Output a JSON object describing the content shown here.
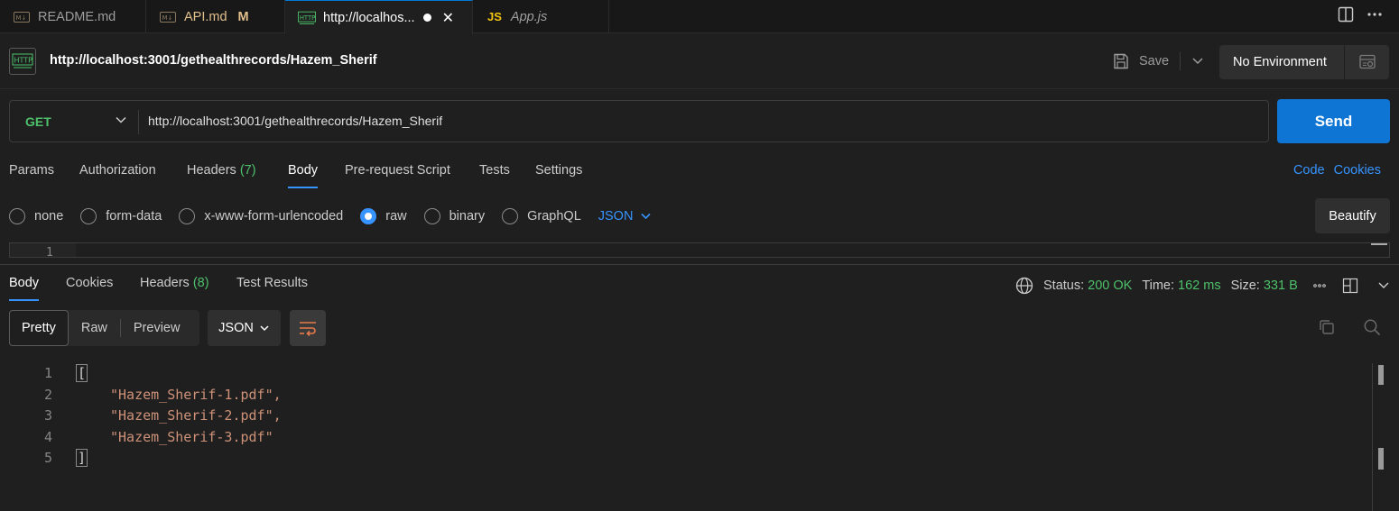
{
  "tabs": [
    {
      "label": "README.md",
      "icon": "markdown-icon"
    },
    {
      "label": "API.md",
      "icon": "markdown-icon",
      "badge": "M"
    },
    {
      "label": "http://localhos...",
      "icon": "http-icon"
    },
    {
      "label": "App.js",
      "icon": "js-icon",
      "icon_text": "JS"
    }
  ],
  "request": {
    "title": "http://localhost:3001/gethealthrecords/Hazem_Sherif",
    "save_label": "Save",
    "environment": "No Environment",
    "method": "GET",
    "url": "http://localhost:3001/gethealthrecords/Hazem_Sherif",
    "send_label": "Send"
  },
  "request_tabs": {
    "params": "Params",
    "authorization": "Authorization",
    "headers": "Headers",
    "headers_count": "(7)",
    "body": "Body",
    "prerequest": "Pre-request Script",
    "tests": "Tests",
    "settings": "Settings",
    "code_link": "Code",
    "cookies_link": "Cookies"
  },
  "body_types": {
    "none": "none",
    "form_data": "form-data",
    "urlencoded": "x-www-form-urlencoded",
    "raw": "raw",
    "binary": "binary",
    "graphql": "GraphQL",
    "format": "JSON",
    "beautify": "Beautify",
    "selected": "raw"
  },
  "request_editor": {
    "line": "1"
  },
  "response_tabs": {
    "body": "Body",
    "cookies": "Cookies",
    "headers": "Headers",
    "headers_count": "(8)",
    "test_results": "Test Results"
  },
  "status": {
    "status_label": "Status:",
    "status_value": "200 OK",
    "time_label": "Time:",
    "time_value": "162 ms",
    "size_label": "Size:",
    "size_value": "331 B"
  },
  "response_view": {
    "pretty": "Pretty",
    "raw": "Raw",
    "preview": "Preview",
    "format": "JSON"
  },
  "response_body": {
    "line_numbers": [
      "1",
      "2",
      "3",
      "4",
      "5"
    ],
    "open_bracket": "[",
    "items": [
      "\"Hazem_Sherif-1.pdf\",",
      "\"Hazem_Sherif-2.pdf\",",
      "\"Hazem_Sherif-3.pdf\""
    ],
    "close_bracket": "]"
  },
  "colors": {
    "accent": "#0e75d4",
    "link": "#3794ff",
    "success": "#4ec06b",
    "string": "#ce9178",
    "modified": "#e2c08d"
  }
}
